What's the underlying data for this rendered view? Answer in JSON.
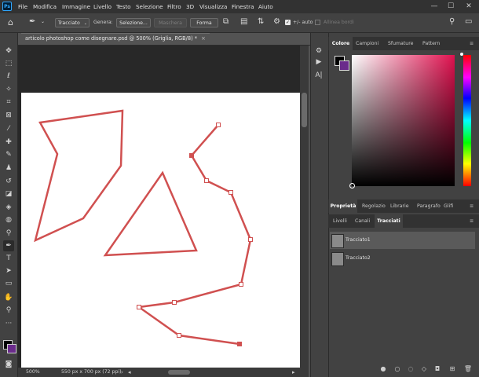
{
  "app": {
    "logo": "Ps"
  },
  "menu": [
    "File",
    "Modifica",
    "Immagine",
    "Livello",
    "Testo",
    "Selezione",
    "Filtro",
    "3D",
    "Visualizza",
    "Finestra",
    "Aiuto"
  ],
  "window_controls": [
    "—",
    "☐",
    "✕"
  ],
  "options": {
    "mode_value": "Tracciato",
    "generate_label": "Genera:",
    "selection_button": "Selezione...",
    "mask_button": "Maschera",
    "shape_button": "Forma",
    "auto_label": "auto",
    "align_edges": "Allinea bordi"
  },
  "document": {
    "tab_label": "articolo photoshop come disegnare.psd @ 500% (Griglia, RGB/8) *",
    "close": "×",
    "zoom": "500%",
    "dimensions": "550 px x 700 px (72 ppi)"
  },
  "tools": [
    "move-icon",
    "marquee-icon",
    "lasso-icon",
    "magic-wand-icon",
    "crop-icon",
    "frame-icon",
    "eyedropper-icon",
    "healing-icon",
    "brush-icon",
    "stamp-icon",
    "history-brush-icon",
    "eraser-icon",
    "gradient-icon",
    "blur-icon",
    "dodge-icon",
    "pen-icon",
    "type-icon",
    "path-select-icon",
    "rectangle-icon",
    "hand-icon",
    "zoom-icon",
    "more-icon"
  ],
  "colors": {
    "foreground": "#000000",
    "background": "#6a2b8b",
    "path_stroke": "#d05050",
    "ui_dark": "#323232",
    "ui_panel": "#424242"
  },
  "color_panel": {
    "tabs": [
      "Colore",
      "Campioni",
      "Sfumature",
      "Pattern"
    ],
    "active_tab": "Colore"
  },
  "properties_panel": {
    "tabs": [
      "Proprietà",
      "Regolazio",
      "Librarie",
      "Paragrafo",
      "Glifi"
    ],
    "active_tab": "Proprietà"
  },
  "layers_panel": {
    "tabs": [
      "Livelli",
      "Canali",
      "Tracciati"
    ],
    "active_tab": "Tracciati",
    "paths": [
      {
        "name": "Tracciato1",
        "selected": true
      },
      {
        "name": "Tracciato2",
        "selected": false
      }
    ]
  },
  "bottom_icons": [
    "fill-path-icon",
    "stroke-path-icon",
    "load-selection-icon",
    "make-path-icon",
    "add-mask-icon",
    "new-path-icon",
    "delete-icon"
  ]
}
